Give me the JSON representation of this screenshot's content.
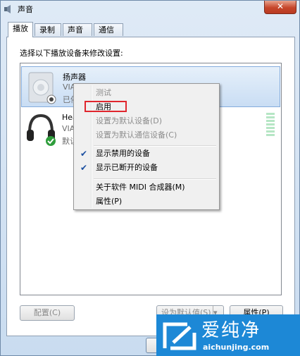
{
  "window": {
    "title": "声音",
    "close_label": "✕"
  },
  "tabs": [
    {
      "label": "播放",
      "active": true
    },
    {
      "label": "录制",
      "active": false
    },
    {
      "label": "声音",
      "active": false
    },
    {
      "label": "通信",
      "active": false
    }
  ],
  "playback": {
    "instruction": "选择以下播放设备来修改设置:",
    "devices": [
      {
        "name": "扬声器",
        "line1": "VIA HD Audio",
        "line2": "已停"
      },
      {
        "name": "Hea",
        "line1": "VIA",
        "line2": "默认"
      }
    ],
    "configure_label": "配置(C)",
    "set_default_label": "设为默认值(S)",
    "properties_label": "属性(P)"
  },
  "context_menu": {
    "items": [
      {
        "label": "测试",
        "disabled": true,
        "checked": false
      },
      {
        "label": "启用",
        "disabled": false,
        "checked": false
      },
      {
        "label": "设置为默认设备(D)",
        "disabled": true,
        "checked": false
      },
      {
        "label": "设置为默认通信设备(C)",
        "disabled": true,
        "checked": false
      },
      {
        "label": "显示禁用的设备",
        "disabled": false,
        "checked": true
      },
      {
        "label": "显示已断开的设备",
        "disabled": false,
        "checked": true
      },
      {
        "label": "关于软件 MIDI 合成器(M)",
        "disabled": false,
        "checked": false
      },
      {
        "label": "属性(P)",
        "disabled": false,
        "checked": false
      }
    ],
    "check_glyph": "✔"
  },
  "watermark": {
    "text": "爱纯净",
    "url": "aichunjing.com"
  },
  "colors": {
    "highlight": "#e0262e",
    "selection": "#c9ddf4",
    "watermark_bg": "#1d88d6"
  }
}
